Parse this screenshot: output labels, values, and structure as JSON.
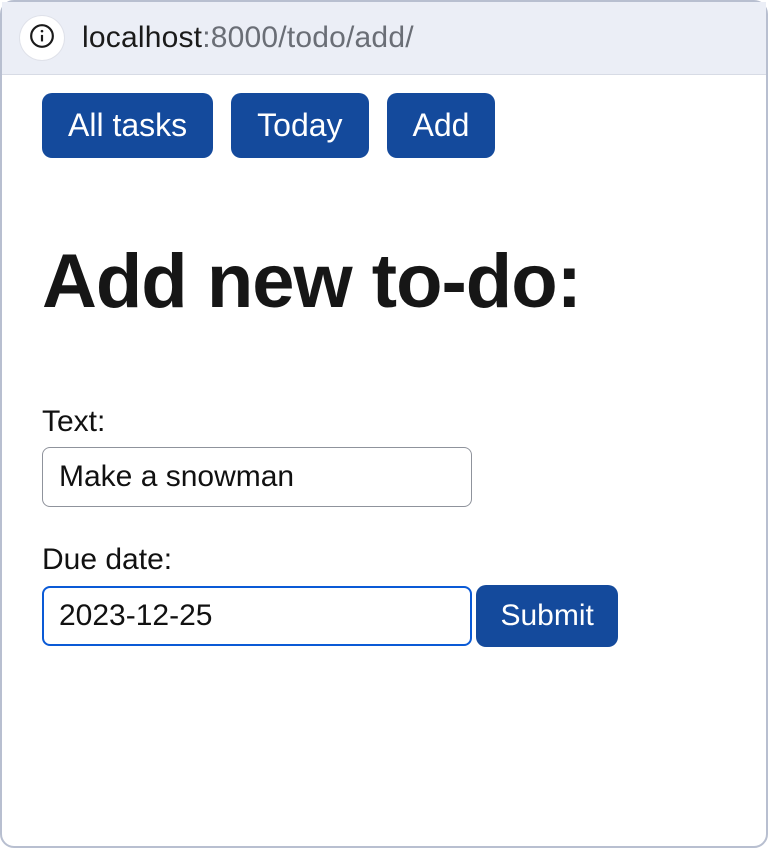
{
  "address_bar": {
    "url_host": "localhost",
    "url_rest": ":8000/todo/add/"
  },
  "nav": {
    "all_tasks": "All tasks",
    "today": "Today",
    "add": "Add"
  },
  "heading": "Add new to-do:",
  "form": {
    "text_label": "Text:",
    "text_value": "Make a snowman",
    "due_label": "Due date:",
    "due_value": "2023-12-25",
    "submit_label": "Submit"
  }
}
